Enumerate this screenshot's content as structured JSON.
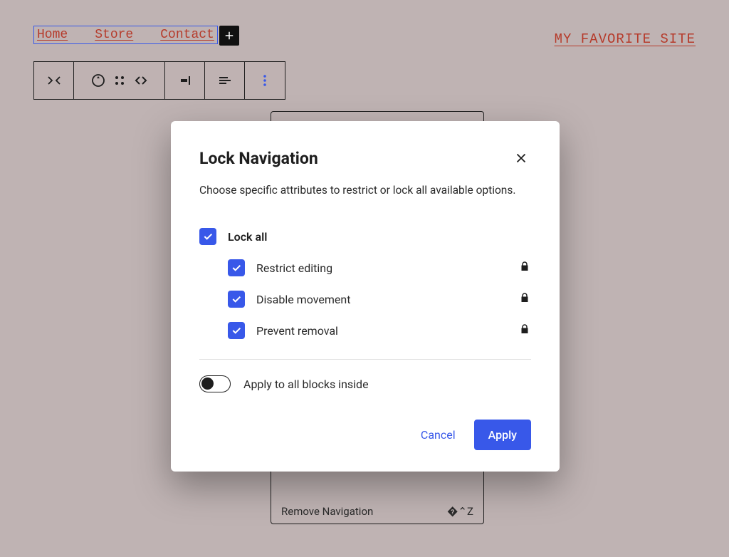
{
  "header": {
    "nav": [
      "Home",
      "Store",
      "Contact"
    ],
    "site_title": "MY FAVORITE SITE"
  },
  "toolbar": {
    "icons": [
      "navigation-block",
      "transform",
      "drag",
      "move-left-right",
      "align-right",
      "align-text-left",
      "options"
    ]
  },
  "ghost_menu": {
    "item_label": "Remove Navigation",
    "shortcut": "�⌃Z"
  },
  "modal": {
    "title": "Lock Navigation",
    "description": "Choose specific attributes to restrict or lock all available options.",
    "lock_all_label": "Lock all",
    "options": [
      {
        "label": "Restrict editing"
      },
      {
        "label": "Disable movement"
      },
      {
        "label": "Prevent removal"
      }
    ],
    "toggle_label": "Apply to all blocks inside",
    "cancel": "Cancel",
    "apply": "Apply"
  }
}
